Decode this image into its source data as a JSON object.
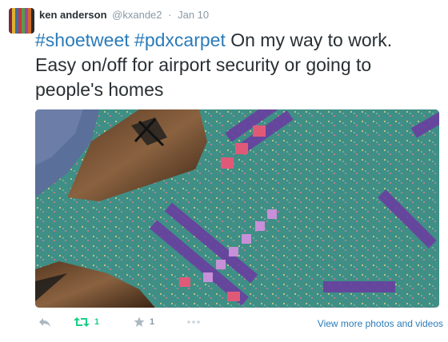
{
  "tweet": {
    "user_name": "ken anderson",
    "handle": "@kxande2",
    "separator": "·",
    "date": "Jan 10",
    "text_parts": {
      "hashtag1": "#shoetweet",
      "hashtag2": "#pdxcarpet",
      "body": "On my way to work. Easy on/off for airport security or going to people's homes"
    }
  },
  "avatar": {
    "stripe_colors": [
      "#7a2a3a",
      "#e0b030",
      "#3a6ea5",
      "#c23b3b",
      "#5a9a4a",
      "#9a4a9a",
      "#d06a2a",
      "#2a2a2a"
    ]
  },
  "media": {
    "description_icon": "photo",
    "carpet_color": "#3f8f86",
    "accent_colors": [
      "#6a3fa0",
      "#e06080",
      "#c890d8"
    ]
  },
  "actions": {
    "reply_icon": "reply-icon",
    "retweet_icon": "retweet-icon",
    "retweet_count": "1",
    "favorite_icon": "star-icon",
    "favorite_count": "1",
    "more_icon": "more-dots-icon",
    "media_link": "View more photos and videos"
  },
  "colors": {
    "link": "#2b7bb9",
    "muted": "#8899a6",
    "retweet": "#19cf86",
    "text": "#292f33"
  }
}
